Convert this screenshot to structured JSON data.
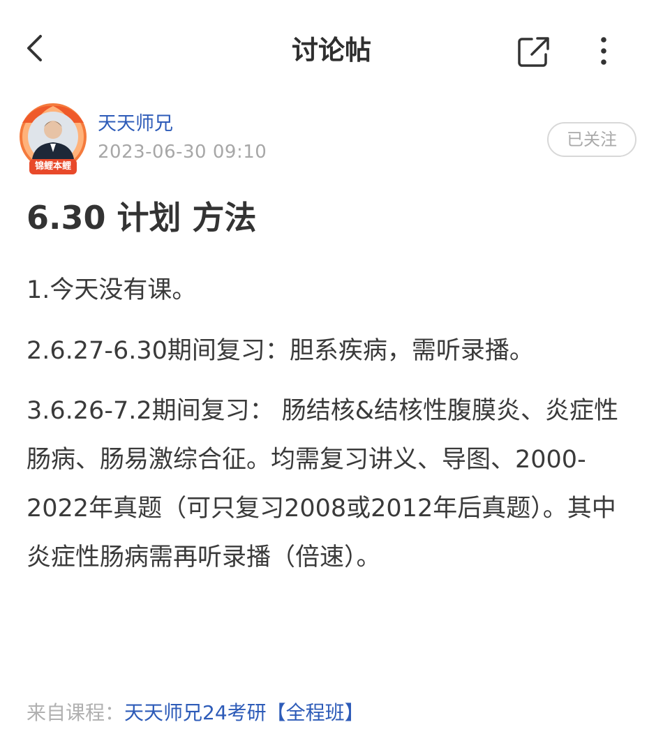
{
  "nav": {
    "title": "讨论帖",
    "back_icon": "chevron-left-icon",
    "share_icon": "share-external-icon",
    "more_icon": "more-vertical-icon"
  },
  "author": {
    "name": "天天师兄",
    "time": "2023-06-30 09:10",
    "follow_label": "已关注",
    "avatar_badge": "锦鲤本鲤"
  },
  "post": {
    "title": "6.30 计划 方法",
    "paragraphs": [
      "1.今天没有课。",
      "2.6.27-6.30期间复习：胆系疾病，需听录播。",
      "3.6.26-7.2期间复习： 肠结核&结核性腹膜炎、炎症性肠病、肠易激综合征。均需复习讲义、导图、2000-2022年真题（可只复习2008或2012年后真题）。其中炎症性肠病需再听录播（倍速）。"
    ]
  },
  "source": {
    "label": "来自课程：",
    "course": "天天师兄24考研【全程班】"
  },
  "colors": {
    "link": "#2d5bb8",
    "muted": "#a7a7a7",
    "text": "#333333"
  }
}
